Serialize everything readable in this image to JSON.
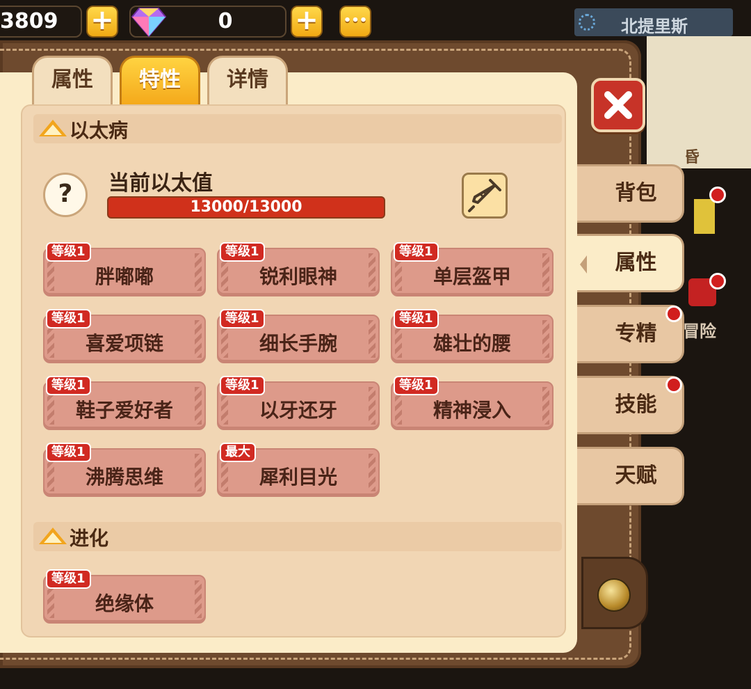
{
  "top_bar": {
    "gold_amount": "3809",
    "gems_amount": "0",
    "more_label": "•••",
    "location": "北提里斯"
  },
  "tabs": [
    {
      "label": "属性",
      "active": false
    },
    {
      "label": "特性",
      "active": true
    },
    {
      "label": "详情",
      "active": false
    }
  ],
  "aether": {
    "section_title": "以太病",
    "value_label": "当前以太值",
    "value_text": "13000/13000",
    "fill_fraction": 1.0,
    "help_symbol": "?"
  },
  "traits": [
    {
      "badge": "等级1",
      "name": "胖嘟嘟"
    },
    {
      "badge": "等级1",
      "name": "锐利眼神"
    },
    {
      "badge": "等级1",
      "name": "单层盔甲"
    },
    {
      "badge": "等级1",
      "name": "喜爱项链"
    },
    {
      "badge": "等级1",
      "name": "细长手腕"
    },
    {
      "badge": "等级1",
      "name": "雄壮的腰"
    },
    {
      "badge": "等级1",
      "name": "鞋子爱好者"
    },
    {
      "badge": "等级1",
      "name": "以牙还牙"
    },
    {
      "badge": "等级1",
      "name": "精神浸入"
    },
    {
      "badge": "等级1",
      "name": "沸腾思维"
    },
    {
      "badge": "最大",
      "name": "犀利目光"
    }
  ],
  "evolution": {
    "section_title": "进化",
    "traits": [
      {
        "badge": "等级1",
        "name": "绝缘体"
      }
    ]
  },
  "side_tabs": [
    {
      "label": "背包",
      "active": false,
      "notify": false
    },
    {
      "label": "属性",
      "active": true,
      "notify": false
    },
    {
      "label": "专精",
      "active": false,
      "notify": true
    },
    {
      "label": "技能",
      "active": false,
      "notify": true
    },
    {
      "label": "天赋",
      "active": false,
      "notify": false
    }
  ],
  "background": {
    "map_label_1": "昏",
    "map_label_2": "冒险"
  },
  "colors": {
    "accent_yellow": "#f4a81a",
    "bar_red": "#d0311b",
    "trait_bg": "#dd9a8a",
    "badge_red": "#d12a22"
  }
}
